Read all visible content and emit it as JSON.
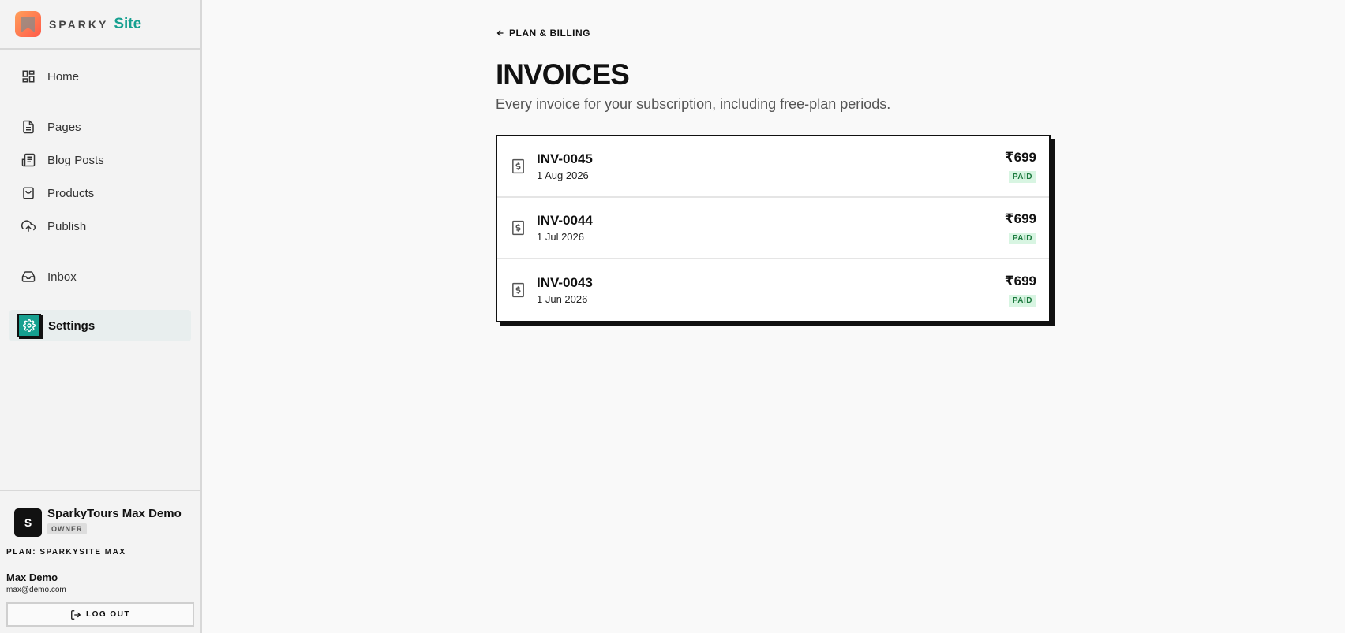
{
  "brand": {
    "name": "SPARKY",
    "suffix": "Site"
  },
  "nav": {
    "home": "Home",
    "pages": "Pages",
    "blog_posts": "Blog Posts",
    "products": "Products",
    "publish": "Publish",
    "inbox": "Inbox",
    "settings": "Settings"
  },
  "account": {
    "avatar_letter": "S",
    "org_name": "SparkyTours Max Demo",
    "role": "OWNER",
    "plan": "PLAN: SPARKYSITE MAX",
    "user_name": "Max Demo",
    "user_email": "max@demo.com",
    "logout_label": "LOG OUT"
  },
  "page": {
    "back_label": "PLAN & BILLING",
    "title": "INVOICES",
    "subtitle": "Every invoice for your subscription, including free-plan periods."
  },
  "invoices": [
    {
      "number": "INV-0045",
      "date": "1 Aug 2026",
      "amount": "₹699",
      "status": "PAID"
    },
    {
      "number": "INV-0044",
      "date": "1 Jul 2026",
      "amount": "₹699",
      "status": "PAID"
    },
    {
      "number": "INV-0043",
      "date": "1 Jun 2026",
      "amount": "₹699",
      "status": "PAID"
    }
  ],
  "colors": {
    "accent": "#16a090",
    "paid_bg": "#d8f5e2",
    "paid_text": "#1c7a3e"
  },
  "icons": {
    "home": "dashboard-icon",
    "pages": "file-icon",
    "blog_posts": "newspaper-icon",
    "products": "shopping-bag-icon",
    "publish": "cloud-upload-icon",
    "inbox": "inbox-icon",
    "settings": "gear-icon",
    "back": "arrow-left-icon",
    "invoice": "receipt-dollar-icon",
    "logout": "log-out-icon"
  }
}
